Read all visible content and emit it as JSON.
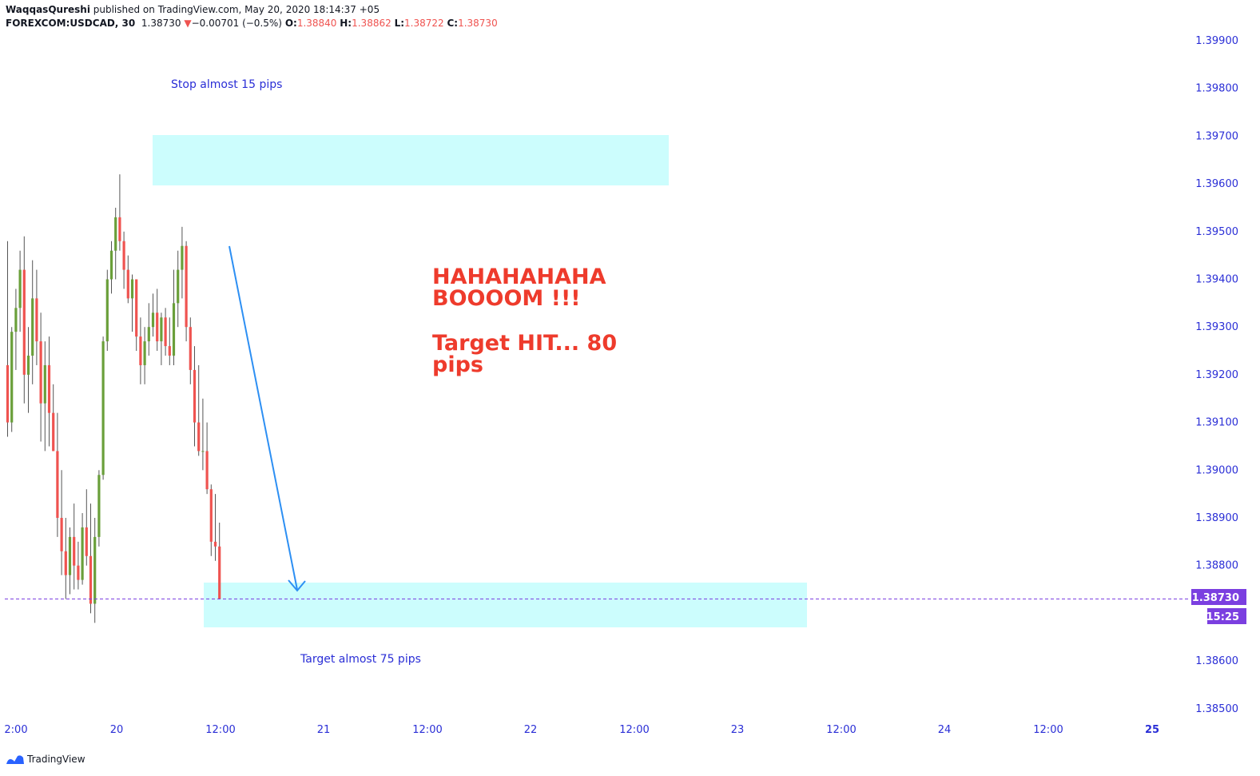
{
  "header": {
    "author": "WaqqasQureshi",
    "published": " published on TradingView.com, May 20, 2020 18:14:37 +05",
    "symbol": "FOREXCOM:USDCAD, 30",
    "last": "1.38730",
    "change": "−0.00701 (−0.5%)",
    "o_label": "O:",
    "o_val": "1.38840",
    "h_label": "H:",
    "h_val": "1.38862",
    "l_label": "L:",
    "l_val": "1.38722",
    "c_label": "C:",
    "c_val": "1.38730"
  },
  "branding": {
    "name": "TradingView"
  },
  "annotations": {
    "stop": "Stop almost 15 pips",
    "target": "Target almost 75 pips",
    "big_line1": "HAHAHAHAHA",
    "big_line2": "BOOOOM !!!",
    "big_line3": "Target HIT... 80",
    "big_line4": "pips"
  },
  "colors": {
    "up": "#6a9f3a",
    "down": "#ef5350",
    "zone": "#ccfdfd",
    "arrow": "#2d8ff3",
    "price_line": "#7b3fe0",
    "axis_text": "#2a2ed6"
  },
  "chart_data": {
    "type": "candlestick",
    "symbol": "FOREXCOM:USDCAD",
    "timeframe": "30",
    "ylim": [
      1.3844,
      1.4001
    ],
    "y_ticks": [
      1.399,
      1.398,
      1.397,
      1.396,
      1.395,
      1.394,
      1.393,
      1.392,
      1.391,
      1.39,
      1.389,
      1.388,
      1.386,
      1.385
    ],
    "y_tick_labels": [
      "1.39900",
      "1.39800",
      "1.39700",
      "1.39600",
      "1.39500",
      "1.39400",
      "1.39300",
      "1.39200",
      "1.39100",
      "1.39000",
      "1.38900",
      "1.38800",
      "1.38600",
      "1.38500"
    ],
    "x_tick_labels": [
      "2:00",
      "20",
      "12:00",
      "21",
      "12:00",
      "22",
      "12:00",
      "23",
      "12:00",
      "24",
      "12:00",
      "25"
    ],
    "last_price_label": "1.38730",
    "countdown_label": "15:25",
    "last_price": 1.3873,
    "candles": [
      {
        "o": 1.3922,
        "h": 1.3948,
        "l": 1.3907,
        "c": 1.391
      },
      {
        "o": 1.391,
        "h": 1.393,
        "l": 1.3908,
        "c": 1.3929
      },
      {
        "o": 1.3929,
        "h": 1.3938,
        "l": 1.3921,
        "c": 1.3934
      },
      {
        "o": 1.3934,
        "h": 1.3946,
        "l": 1.3929,
        "c": 1.3942
      },
      {
        "o": 1.3942,
        "h": 1.3949,
        "l": 1.3914,
        "c": 1.392
      },
      {
        "o": 1.392,
        "h": 1.393,
        "l": 1.3912,
        "c": 1.3924
      },
      {
        "o": 1.3924,
        "h": 1.3944,
        "l": 1.3918,
        "c": 1.3936
      },
      {
        "o": 1.3936,
        "h": 1.3942,
        "l": 1.3922,
        "c": 1.3927
      },
      {
        "o": 1.3927,
        "h": 1.3933,
        "l": 1.3906,
        "c": 1.3914
      },
      {
        "o": 1.3914,
        "h": 1.3927,
        "l": 1.3904,
        "c": 1.3922
      },
      {
        "o": 1.3922,
        "h": 1.3928,
        "l": 1.3905,
        "c": 1.3912
      },
      {
        "o": 1.3912,
        "h": 1.3918,
        "l": 1.3904,
        "c": 1.3904
      },
      {
        "o": 1.3904,
        "h": 1.3912,
        "l": 1.3886,
        "c": 1.389
      },
      {
        "o": 1.389,
        "h": 1.39,
        "l": 1.3878,
        "c": 1.3883
      },
      {
        "o": 1.3883,
        "h": 1.389,
        "l": 1.3873,
        "c": 1.3878
      },
      {
        "o": 1.3878,
        "h": 1.3888,
        "l": 1.3874,
        "c": 1.3886
      },
      {
        "o": 1.3886,
        "h": 1.3893,
        "l": 1.3875,
        "c": 1.388
      },
      {
        "o": 1.388,
        "h": 1.3885,
        "l": 1.3875,
        "c": 1.3877
      },
      {
        "o": 1.3877,
        "h": 1.3891,
        "l": 1.3876,
        "c": 1.3888
      },
      {
        "o": 1.3888,
        "h": 1.3896,
        "l": 1.388,
        "c": 1.3882
      },
      {
        "o": 1.3882,
        "h": 1.3893,
        "l": 1.387,
        "c": 1.3872
      },
      {
        "o": 1.3872,
        "h": 1.389,
        "l": 1.3868,
        "c": 1.3886
      },
      {
        "o": 1.3886,
        "h": 1.39,
        "l": 1.3884,
        "c": 1.3899
      },
      {
        "o": 1.3899,
        "h": 1.3928,
        "l": 1.3898,
        "c": 1.3927
      },
      {
        "o": 1.3927,
        "h": 1.3942,
        "l": 1.3925,
        "c": 1.394
      },
      {
        "o": 1.394,
        "h": 1.3948,
        "l": 1.3937,
        "c": 1.3946
      },
      {
        "o": 1.3946,
        "h": 1.3955,
        "l": 1.394,
        "c": 1.3953
      },
      {
        "o": 1.3953,
        "h": 1.3962,
        "l": 1.3946,
        "c": 1.3948
      },
      {
        "o": 1.3948,
        "h": 1.395,
        "l": 1.3938,
        "c": 1.3942
      },
      {
        "o": 1.3942,
        "h": 1.3945,
        "l": 1.3935,
        "c": 1.3936
      },
      {
        "o": 1.3936,
        "h": 1.3941,
        "l": 1.3929,
        "c": 1.394
      },
      {
        "o": 1.394,
        "h": 1.394,
        "l": 1.3925,
        "c": 1.3928
      },
      {
        "o": 1.3928,
        "h": 1.3932,
        "l": 1.3918,
        "c": 1.3922
      },
      {
        "o": 1.3922,
        "h": 1.393,
        "l": 1.3918,
        "c": 1.3927
      },
      {
        "o": 1.3927,
        "h": 1.3935,
        "l": 1.3924,
        "c": 1.393
      },
      {
        "o": 1.393,
        "h": 1.3937,
        "l": 1.3928,
        "c": 1.3933
      },
      {
        "o": 1.3933,
        "h": 1.3938,
        "l": 1.3925,
        "c": 1.3927
      },
      {
        "o": 1.3927,
        "h": 1.3933,
        "l": 1.3922,
        "c": 1.3932
      },
      {
        "o": 1.3932,
        "h": 1.3934,
        "l": 1.3924,
        "c": 1.3926
      },
      {
        "o": 1.3926,
        "h": 1.3932,
        "l": 1.3922,
        "c": 1.3924
      },
      {
        "o": 1.3924,
        "h": 1.3942,
        "l": 1.3922,
        "c": 1.3935
      },
      {
        "o": 1.3935,
        "h": 1.3946,
        "l": 1.393,
        "c": 1.3942
      },
      {
        "o": 1.3942,
        "h": 1.3951,
        "l": 1.3936,
        "c": 1.3947
      },
      {
        "o": 1.3947,
        "h": 1.3948,
        "l": 1.3927,
        "c": 1.393
      },
      {
        "o": 1.393,
        "h": 1.3932,
        "l": 1.3918,
        "c": 1.3921
      },
      {
        "o": 1.3921,
        "h": 1.3926,
        "l": 1.3905,
        "c": 1.391
      },
      {
        "o": 1.391,
        "h": 1.3922,
        "l": 1.3903,
        "c": 1.3904
      },
      {
        "o": 1.3904,
        "h": 1.3915,
        "l": 1.39,
        "c": 1.3904
      },
      {
        "o": 1.3904,
        "h": 1.391,
        "l": 1.3895,
        "c": 1.3896
      },
      {
        "o": 1.3896,
        "h": 1.3897,
        "l": 1.3882,
        "c": 1.3885
      },
      {
        "o": 1.3885,
        "h": 1.3895,
        "l": 1.3881,
        "c": 1.3884
      },
      {
        "o": 1.3884,
        "h": 1.3889,
        "l": 1.3873,
        "c": 1.3873
      }
    ]
  }
}
